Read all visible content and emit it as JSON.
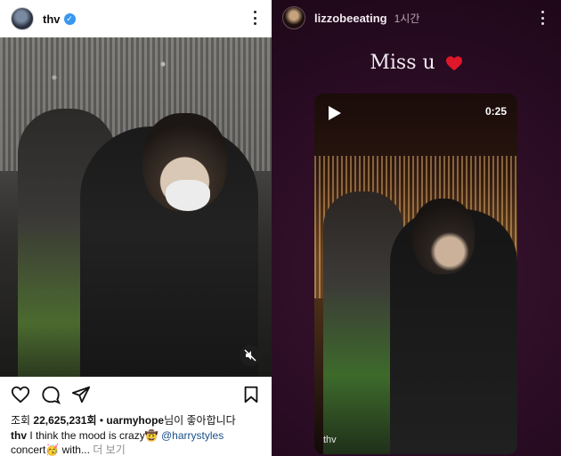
{
  "left_post": {
    "username": "thv",
    "likes_prefix": "조회 ",
    "likes_count": "22,625,231회",
    "likes_separator": " • ",
    "liked_by": "uarmyhope",
    "likes_suffix": "님이 좋아합니다",
    "caption_user": "thv",
    "caption_text": " I think the mood is crazy🤠 ",
    "caption_tag": "@harrystyles",
    "caption_text2": "concert🥳 with...",
    "caption_more": " 더 보기"
  },
  "story": {
    "username": "lizzobeeating",
    "time": "1시간",
    "overlay_text": "Miss u",
    "video_duration": "0:25",
    "watermark": "thv"
  },
  "colors": {
    "verified_blue": "#3897f0",
    "tag_blue": "#1a4f8a",
    "story_bg": "#2a0c24",
    "heart_red": "#e0172a"
  },
  "icons": [
    "verified-icon",
    "more-icon",
    "mute-icon",
    "heart-icon",
    "comment-icon",
    "share-icon",
    "bookmark-icon",
    "play-icon"
  ]
}
